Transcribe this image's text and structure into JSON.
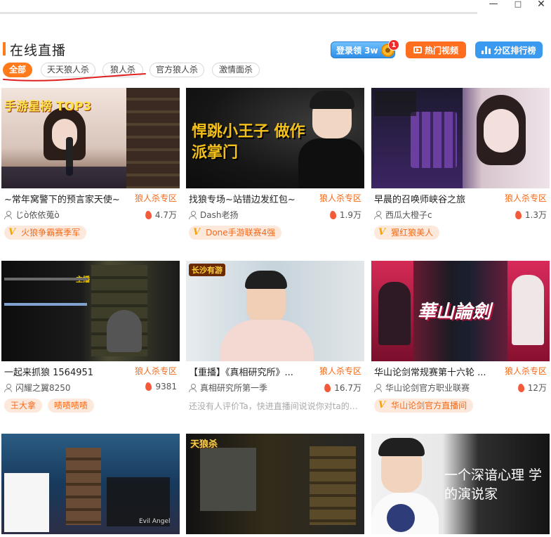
{
  "window": {
    "min": "—",
    "max": "□",
    "close": "✕"
  },
  "header": {
    "title": "在线直播",
    "login_label": "登录领 3w",
    "login_badge": "1",
    "hot_video_label": "热门视频",
    "rank_label": "分区排行榜"
  },
  "tabs": [
    {
      "label": "全部",
      "active": true
    },
    {
      "label": "天天狼人杀",
      "active": false
    },
    {
      "label": "狼人杀",
      "active": false
    },
    {
      "label": "官方狼人杀",
      "active": false
    },
    {
      "label": "激情面杀",
      "active": false
    }
  ],
  "cards": [
    {
      "thumb_text": "手游星榜 TOP3",
      "title": "~常年窝警下的预言家天使~",
      "tag": "狼人杀专区",
      "user": "じò依依蒐ò",
      "views": "4.7万",
      "badge": "火狼争霸赛季军"
    },
    {
      "thumb_text": "悍跳小王子 做作派掌门",
      "title": "找狼专场~站错边发红包~",
      "tag": "狼人杀专区",
      "user": "Dash老扬",
      "views": "1.9万",
      "badge": "Done手游联赛4强"
    },
    {
      "thumb_text": "",
      "title": "早晨的召唤师峡谷之旅",
      "tag": "狼人杀专区",
      "user": "西瓜大橙子c",
      "views": "1.3万",
      "badge": "猩红狼美人"
    },
    {
      "thumb_text": "主播",
      "title": "一起来抓狼 1564951",
      "tag": "狼人杀专区",
      "user": "闪耀之翼8250",
      "views": "9381",
      "chips": [
        "王大拿",
        "啧啧啧啧"
      ]
    },
    {
      "thumb_text": "长沙有游",
      "title": "【重播】《真相研究所》...",
      "tag": "狼人杀专区",
      "user": "真相研究所第一季",
      "views": "16.7万",
      "comment": "还没有人评价Ta，快进直播间说说你对ta的印..."
    },
    {
      "thumb_text": "華山論劍",
      "title": "华山论剑常规赛第十六轮 ...",
      "tag": "狼人杀专区",
      "user": "华山论剑官方职业联赛",
      "views": "12万",
      "badge": "华山论剑官方直播间"
    },
    {
      "thumb_text": "Evil Angel",
      "title": "",
      "tag": "",
      "user": "",
      "views": ""
    },
    {
      "thumb_text": "天狼杀",
      "title": "",
      "tag": "",
      "user": "",
      "views": ""
    },
    {
      "thumb_text": "一个深谙心理 学的演说家",
      "title": "",
      "tag": "",
      "user": "",
      "views": ""
    }
  ]
}
